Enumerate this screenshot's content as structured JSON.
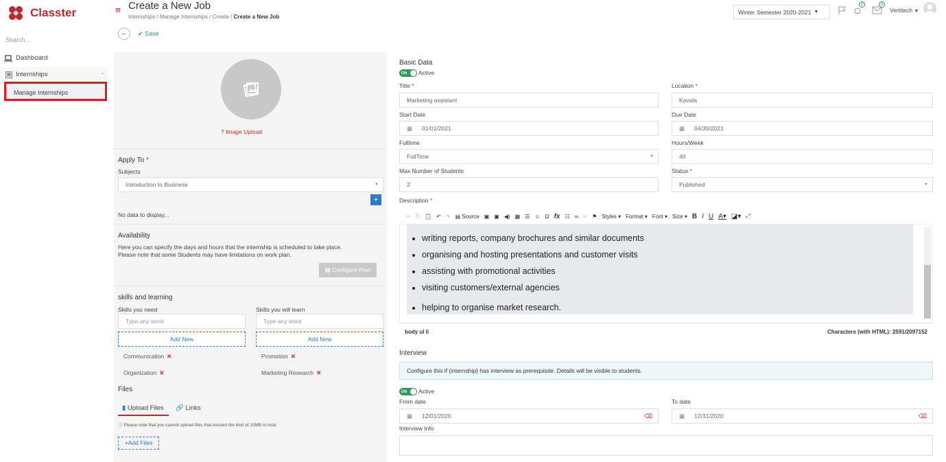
{
  "app": {
    "brand": "Classter"
  },
  "sidebar": {
    "search_placeholder": "Search...",
    "items": [
      {
        "label": "Dashboard"
      },
      {
        "label": "Internships"
      },
      {
        "label": "Manage Internships"
      }
    ]
  },
  "header": {
    "title": "Create a New Job",
    "breadcrumb": [
      "Internships",
      "Manage Internships",
      "Create",
      "Create a New Job"
    ],
    "semester": "Winter Semester 2020-2021",
    "notif_count": "0",
    "mail_count": "0",
    "user": "Vertitech"
  },
  "toolbar": {
    "save_label": "Save"
  },
  "left": {
    "image_upload": "Image Upload",
    "apply_to": "Apply To",
    "subjects_label": "Subjects",
    "subjects_value": "Introduction to Business",
    "no_data": "No data to display...",
    "availability_title": "Availability",
    "availability_text_1": "Here you can specify the days and hours that the internship is scheduled to take place.",
    "availability_text_2": "Please note that some Students may have limitations on work plan.",
    "configure_plan": "Configure Plan",
    "skills_title": "skills and learning",
    "skills_need_label": "Skills you need",
    "skills_learn_label": "Skills you will learn",
    "type_placeholder": "Type any word",
    "add_new": "Add New",
    "skills_need": [
      "Communication",
      "Organization"
    ],
    "skills_learn": [
      "Promotion",
      "Marketing Research"
    ],
    "files_title": "Files",
    "upload_files_tab": "Upload Files",
    "links_tab": "Links",
    "files_note": "Please note that you cannot upload files that exceed the limit of 15MB in total.",
    "add_files": "Add Files"
  },
  "right": {
    "basic_data": "Basic Data",
    "active_label": "Active",
    "toggle_on": "ON",
    "title_label": "Title",
    "title_value": "Marketing assistant",
    "location_label": "Location",
    "location_value": "Kavala",
    "start_date_label": "Start Date",
    "start_date_value": "01/01/2021",
    "due_date_label": "Due Date",
    "due_date_value": "04/30/2021",
    "fulltime_label": "Fulltime",
    "fulltime_value": "FullTime",
    "hours_label": "Hours/Week",
    "hours_value": "40",
    "max_students_label": "Max Number of Students",
    "max_students_value": "2",
    "status_label": "Status",
    "status_value": "Published",
    "description_label": "Description",
    "editor_tools": [
      "Source",
      "Styles",
      "Format",
      "Font",
      "Size"
    ],
    "description_items": [
      "writing reports, company brochures and similar documents",
      "organising and hosting presentations and customer visits",
      "assisting with promotional activities",
      "visiting customers/external agencies",
      "helping to organise market research."
    ],
    "editor_path": "body  ul  li",
    "char_count": "Characters (with HTML): 2591/2097152",
    "interview_title": "Interview",
    "interview_info_text": "Configure this if {internship} has interview as prerequisite. Details will be visible to students.",
    "from_date_label": "From date",
    "from_date_value": "12/01/2020",
    "to_date_label": "To date",
    "to_date_value": "12/31/2020",
    "interview_info_label": "Interview Info"
  },
  "colors": {
    "brand": "#c0272d",
    "accent": "#2a7cc7",
    "success": "#2e9e5b",
    "highlight": "#e0191f"
  }
}
